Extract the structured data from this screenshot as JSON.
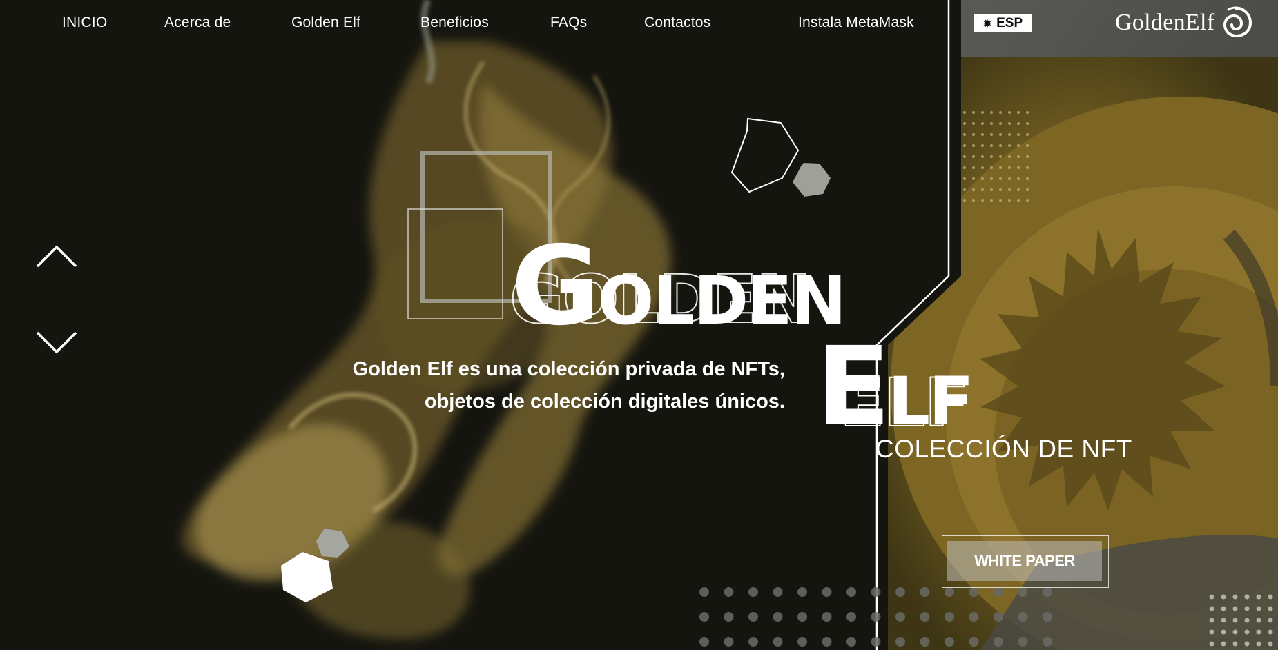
{
  "nav": {
    "items": [
      {
        "label": "INICIO"
      },
      {
        "label": "Acerca de"
      },
      {
        "label": "Golden Elf"
      },
      {
        "label": "Beneficios"
      },
      {
        "label": "FAQs"
      },
      {
        "label": "Contactos"
      },
      {
        "label": "Instala MetaMask"
      }
    ],
    "language": {
      "label": "ESP",
      "icon": "sun-icon"
    },
    "logo": {
      "text": "GoldenElf",
      "icon": "spiral-icon"
    }
  },
  "hero": {
    "title_word_1": {
      "initial": "G",
      "rest": "OLDEN"
    },
    "title_word_2": {
      "initial": "E",
      "rest": "LF"
    },
    "subtitle_line_1": "Golden Elf es una colección privada de NFTs,",
    "subtitle_line_2": "objetos de colección digitales únicos.",
    "collection_label": "COLECCIÓN DE NFT",
    "cta_label": "WHITE PAPER"
  },
  "slider": {
    "prev_icon": "chevron-up-icon",
    "next_icon": "chevron-down-icon"
  },
  "colors": {
    "background": "#151510",
    "gold": "#a98a2a",
    "gold_dark": "#5a4a18",
    "panel_gray": "#4a4a48",
    "text": "#ffffff"
  }
}
